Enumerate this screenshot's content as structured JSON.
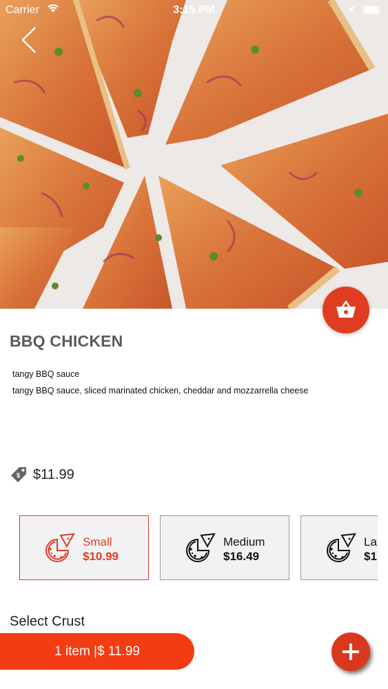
{
  "status_bar": {
    "carrier": "Carrier",
    "time": "3:15 PM"
  },
  "header": {
    "back_icon": "chevron-left-icon"
  },
  "product": {
    "name": "BBQ CHICKEN",
    "short_description": "tangy BBQ sauce",
    "long_description": "tangy BBQ sauce, sliced marinated chicken, cheddar and mozzarrella cheese",
    "price": "$11.99",
    "price_icon": "price-tag-icon"
  },
  "sizes": [
    {
      "name": "Small",
      "price": "$10.99",
      "selected": true
    },
    {
      "name": "Medium",
      "price": "$16.49",
      "selected": false
    },
    {
      "name": "La",
      "price": "$1",
      "selected": false
    }
  ],
  "crust": {
    "label": "Select Crust"
  },
  "cart": {
    "summary": "1 item |$ 11.99",
    "cart_icon": "basket-icon",
    "add_icon": "plus-icon"
  },
  "colors": {
    "accent": "#e03c21",
    "bar": "#f33c12",
    "title": "#5b5b5b"
  }
}
